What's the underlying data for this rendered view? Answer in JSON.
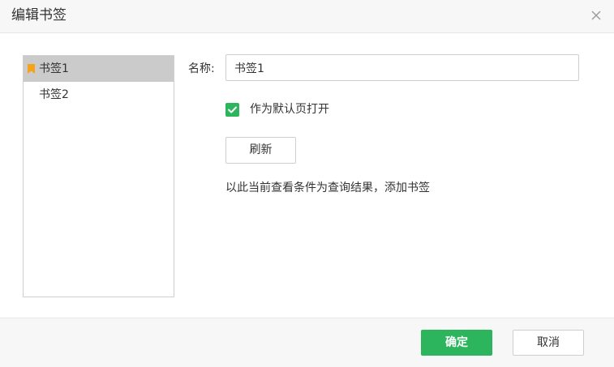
{
  "dialog": {
    "title": "编辑书签",
    "close_icon": "close-icon"
  },
  "bookmarks": {
    "items": [
      {
        "label": "书签1",
        "selected": true,
        "icon": "bookmark-icon"
      },
      {
        "label": "书签2",
        "selected": false
      }
    ]
  },
  "form": {
    "name_label": "名称:",
    "name_value": "书签1",
    "default_checkbox_checked": true,
    "default_label": "作为默认页打开",
    "refresh_label": "刷新",
    "hint": "以此当前查看条件为查询结果，添加书签"
  },
  "footer": {
    "ok_label": "确定",
    "cancel_label": "取消"
  },
  "colors": {
    "accent": "#2db55d",
    "bookmark": "#f7a21b",
    "selected_bg": "#cbcbcb",
    "header_bg": "#f7f7f7"
  }
}
